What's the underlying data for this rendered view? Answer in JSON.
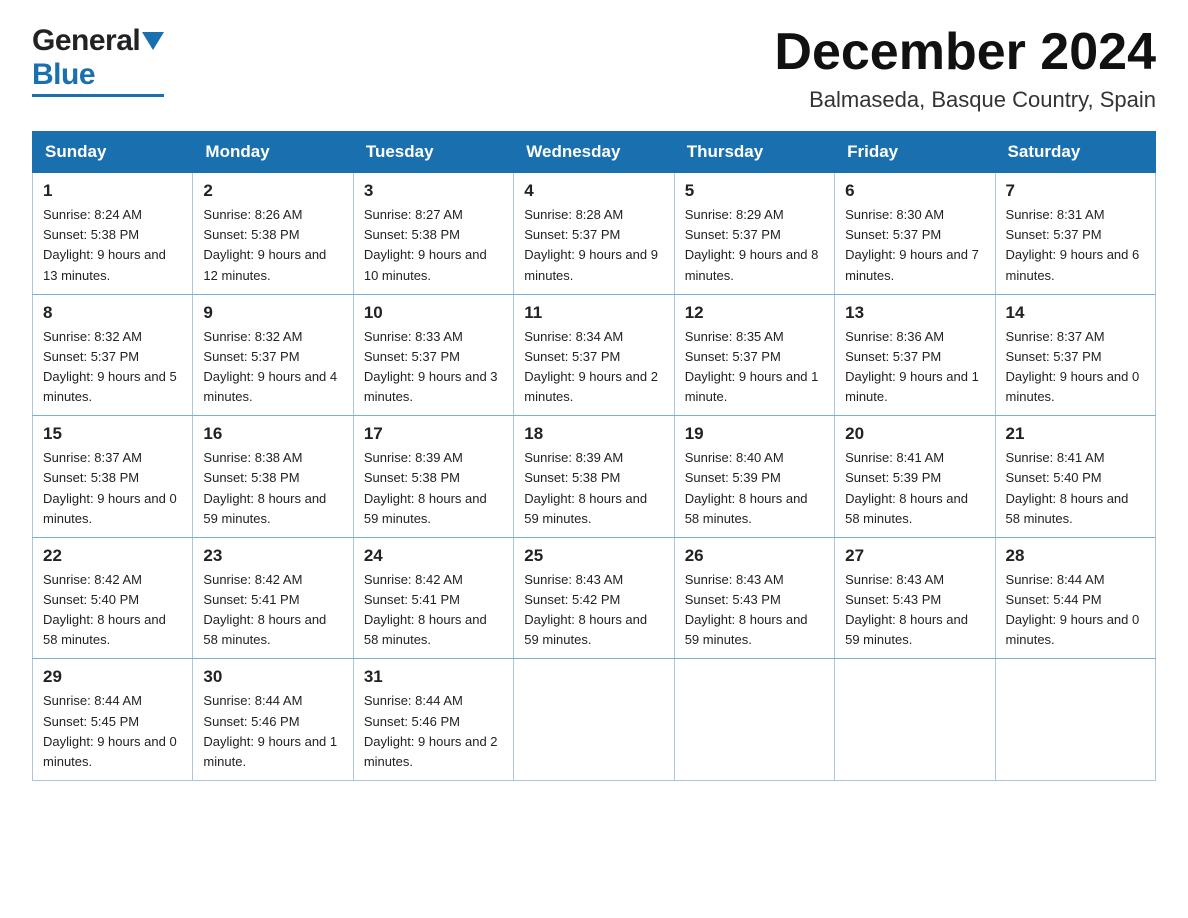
{
  "header": {
    "logo_general": "General",
    "logo_blue": "Blue",
    "month_title": "December 2024",
    "location": "Balmaseda, Basque Country, Spain"
  },
  "weekdays": [
    "Sunday",
    "Monday",
    "Tuesday",
    "Wednesday",
    "Thursday",
    "Friday",
    "Saturday"
  ],
  "weeks": [
    [
      {
        "day": "1",
        "sunrise": "8:24 AM",
        "sunset": "5:38 PM",
        "daylight": "9 hours and 13 minutes."
      },
      {
        "day": "2",
        "sunrise": "8:26 AM",
        "sunset": "5:38 PM",
        "daylight": "9 hours and 12 minutes."
      },
      {
        "day": "3",
        "sunrise": "8:27 AM",
        "sunset": "5:38 PM",
        "daylight": "9 hours and 10 minutes."
      },
      {
        "day": "4",
        "sunrise": "8:28 AM",
        "sunset": "5:37 PM",
        "daylight": "9 hours and 9 minutes."
      },
      {
        "day": "5",
        "sunrise": "8:29 AM",
        "sunset": "5:37 PM",
        "daylight": "9 hours and 8 minutes."
      },
      {
        "day": "6",
        "sunrise": "8:30 AM",
        "sunset": "5:37 PM",
        "daylight": "9 hours and 7 minutes."
      },
      {
        "day": "7",
        "sunrise": "8:31 AM",
        "sunset": "5:37 PM",
        "daylight": "9 hours and 6 minutes."
      }
    ],
    [
      {
        "day": "8",
        "sunrise": "8:32 AM",
        "sunset": "5:37 PM",
        "daylight": "9 hours and 5 minutes."
      },
      {
        "day": "9",
        "sunrise": "8:32 AM",
        "sunset": "5:37 PM",
        "daylight": "9 hours and 4 minutes."
      },
      {
        "day": "10",
        "sunrise": "8:33 AM",
        "sunset": "5:37 PM",
        "daylight": "9 hours and 3 minutes."
      },
      {
        "day": "11",
        "sunrise": "8:34 AM",
        "sunset": "5:37 PM",
        "daylight": "9 hours and 2 minutes."
      },
      {
        "day": "12",
        "sunrise": "8:35 AM",
        "sunset": "5:37 PM",
        "daylight": "9 hours and 1 minute."
      },
      {
        "day": "13",
        "sunrise": "8:36 AM",
        "sunset": "5:37 PM",
        "daylight": "9 hours and 1 minute."
      },
      {
        "day": "14",
        "sunrise": "8:37 AM",
        "sunset": "5:37 PM",
        "daylight": "9 hours and 0 minutes."
      }
    ],
    [
      {
        "day": "15",
        "sunrise": "8:37 AM",
        "sunset": "5:38 PM",
        "daylight": "9 hours and 0 minutes."
      },
      {
        "day": "16",
        "sunrise": "8:38 AM",
        "sunset": "5:38 PM",
        "daylight": "8 hours and 59 minutes."
      },
      {
        "day": "17",
        "sunrise": "8:39 AM",
        "sunset": "5:38 PM",
        "daylight": "8 hours and 59 minutes."
      },
      {
        "day": "18",
        "sunrise": "8:39 AM",
        "sunset": "5:38 PM",
        "daylight": "8 hours and 59 minutes."
      },
      {
        "day": "19",
        "sunrise": "8:40 AM",
        "sunset": "5:39 PM",
        "daylight": "8 hours and 58 minutes."
      },
      {
        "day": "20",
        "sunrise": "8:41 AM",
        "sunset": "5:39 PM",
        "daylight": "8 hours and 58 minutes."
      },
      {
        "day": "21",
        "sunrise": "8:41 AM",
        "sunset": "5:40 PM",
        "daylight": "8 hours and 58 minutes."
      }
    ],
    [
      {
        "day": "22",
        "sunrise": "8:42 AM",
        "sunset": "5:40 PM",
        "daylight": "8 hours and 58 minutes."
      },
      {
        "day": "23",
        "sunrise": "8:42 AM",
        "sunset": "5:41 PM",
        "daylight": "8 hours and 58 minutes."
      },
      {
        "day": "24",
        "sunrise": "8:42 AM",
        "sunset": "5:41 PM",
        "daylight": "8 hours and 58 minutes."
      },
      {
        "day": "25",
        "sunrise": "8:43 AM",
        "sunset": "5:42 PM",
        "daylight": "8 hours and 59 minutes."
      },
      {
        "day": "26",
        "sunrise": "8:43 AM",
        "sunset": "5:43 PM",
        "daylight": "8 hours and 59 minutes."
      },
      {
        "day": "27",
        "sunrise": "8:43 AM",
        "sunset": "5:43 PM",
        "daylight": "8 hours and 59 minutes."
      },
      {
        "day": "28",
        "sunrise": "8:44 AM",
        "sunset": "5:44 PM",
        "daylight": "9 hours and 0 minutes."
      }
    ],
    [
      {
        "day": "29",
        "sunrise": "8:44 AM",
        "sunset": "5:45 PM",
        "daylight": "9 hours and 0 minutes."
      },
      {
        "day": "30",
        "sunrise": "8:44 AM",
        "sunset": "5:46 PM",
        "daylight": "9 hours and 1 minute."
      },
      {
        "day": "31",
        "sunrise": "8:44 AM",
        "sunset": "5:46 PM",
        "daylight": "9 hours and 2 minutes."
      },
      null,
      null,
      null,
      null
    ]
  ]
}
